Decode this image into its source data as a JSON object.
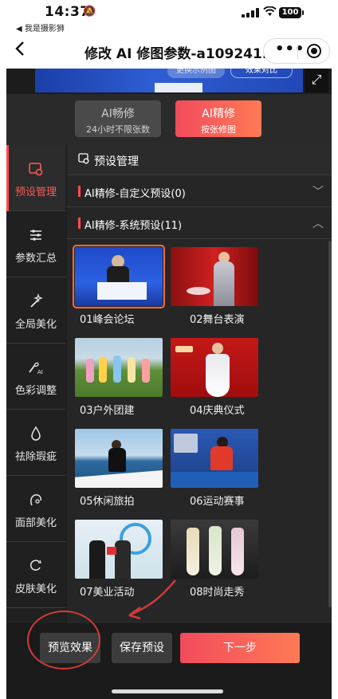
{
  "status": {
    "time": "14:37",
    "back_app": "◀ 我是摄影狮",
    "battery": "100"
  },
  "nav": {
    "title": "修改 AI 修图参数-a109241...",
    "more": "•••"
  },
  "preview": {
    "slot_text": "更换示例图",
    "compare_text": "效果对比"
  },
  "mode_tabs": [
    {
      "title": "AI畅修",
      "subtitle": "24小时不限张数"
    },
    {
      "title": "AI精修",
      "subtitle": "按张修图"
    }
  ],
  "sidebar": {
    "items": [
      {
        "icon": "preset-icon",
        "label": "预设管理"
      },
      {
        "icon": "sliders-icon",
        "label": "参数汇总"
      },
      {
        "icon": "magic-wand-icon",
        "label": "全局美化"
      },
      {
        "icon": "palette-ai-icon",
        "label": "色彩调整"
      },
      {
        "icon": "droplet-icon",
        "label": "祛除瑕疵"
      },
      {
        "icon": "face-icon",
        "label": "面部美化"
      },
      {
        "icon": "skin-icon",
        "label": "皮肤美化"
      }
    ]
  },
  "section": {
    "title": "预设管理"
  },
  "groups": [
    {
      "label": "AI精修-自定义预设(0)",
      "chevron": "﹀"
    },
    {
      "label": "AI精修-系统预设(11)",
      "chevron": "︿"
    }
  ],
  "presets": [
    {
      "label": "01峰会论坛"
    },
    {
      "label": "02舞台表演"
    },
    {
      "label": "03户外团建"
    },
    {
      "label": "04庆典仪式"
    },
    {
      "label": "05休闲旅拍"
    },
    {
      "label": "06运动赛事"
    },
    {
      "label": "07美业活动"
    },
    {
      "label": "08时尚走秀"
    }
  ],
  "bottom": {
    "preview_label": "预览效果",
    "save_label": "保存预设",
    "next_label": "下一步"
  },
  "colors": {
    "accent": "#ff4d4f",
    "annotation": "#d23b3b"
  }
}
